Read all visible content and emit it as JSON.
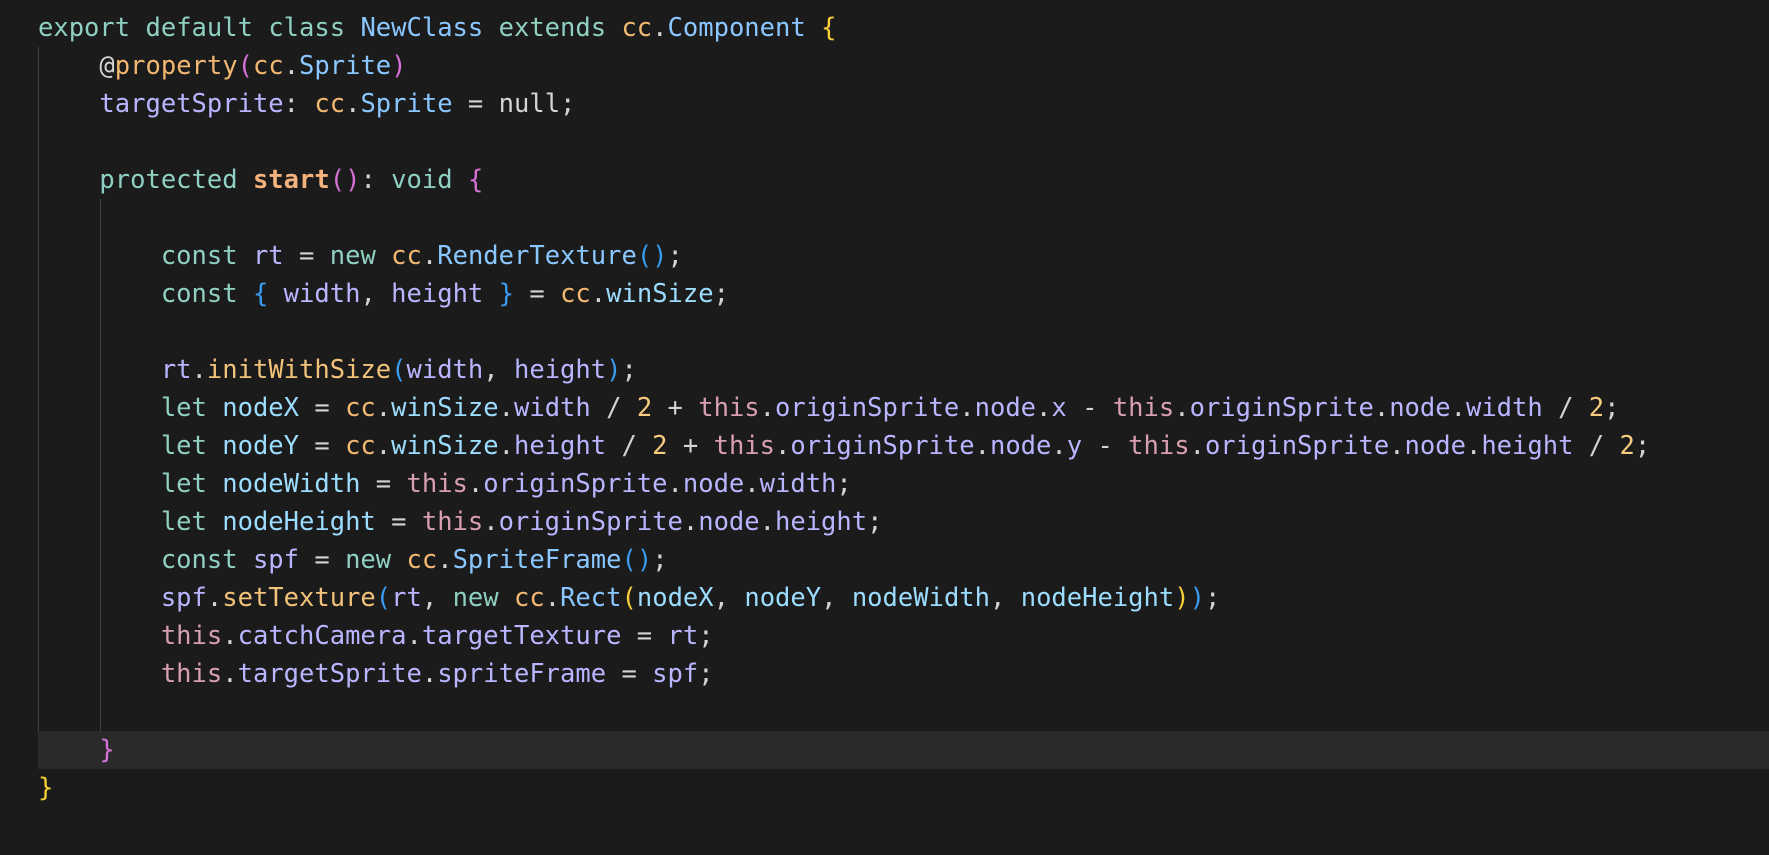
{
  "editor": {
    "theme_colors": {
      "background": "#1b1b1b",
      "current_line": "#2a2a2a",
      "keyword": "#8fd0c3",
      "class_name": "#8ac7ff",
      "cc_namespace": "#f2b872",
      "identifier": "#b9b5ff",
      "number": "#f7cc7d",
      "this_keyword": "#d8a0ae",
      "bracket_gold": "#f7d038",
      "bracket_pink": "#d672d6",
      "bracket_blue": "#3a9cf0"
    },
    "current_line_index": 19,
    "lines": [
      [
        {
          "t": "export",
          "c": "keyword"
        },
        {
          "t": " ",
          "c": "punct"
        },
        {
          "t": "default",
          "c": "keyword"
        },
        {
          "t": " ",
          "c": "punct"
        },
        {
          "t": "class",
          "c": "keyword"
        },
        {
          "t": " ",
          "c": "punct"
        },
        {
          "t": "NewClass",
          "c": "class-name"
        },
        {
          "t": " ",
          "c": "punct"
        },
        {
          "t": "extends",
          "c": "keyword"
        },
        {
          "t": " ",
          "c": "punct"
        },
        {
          "t": "cc",
          "c": "cc"
        },
        {
          "t": ".",
          "c": "punct"
        },
        {
          "t": "Component",
          "c": "class-name"
        },
        {
          "t": " ",
          "c": "punct"
        },
        {
          "t": "{",
          "c": "bracket-gold"
        }
      ],
      [
        {
          "t": "    ",
          "c": "punct"
        },
        {
          "t": "@",
          "c": "decorator"
        },
        {
          "t": "property",
          "c": "property-dec"
        },
        {
          "t": "(",
          "c": "bracket-pink"
        },
        {
          "t": "cc",
          "c": "cc"
        },
        {
          "t": ".",
          "c": "punct"
        },
        {
          "t": "Sprite",
          "c": "class-name"
        },
        {
          "t": ")",
          "c": "bracket-pink"
        }
      ],
      [
        {
          "t": "    ",
          "c": "punct"
        },
        {
          "t": "targetSprite",
          "c": "identifier"
        },
        {
          "t": ": ",
          "c": "punct"
        },
        {
          "t": "cc",
          "c": "cc"
        },
        {
          "t": ".",
          "c": "punct"
        },
        {
          "t": "Sprite",
          "c": "class-name"
        },
        {
          "t": " = null;",
          "c": "punct"
        }
      ],
      [],
      [
        {
          "t": "    ",
          "c": "punct"
        },
        {
          "t": "protected",
          "c": "keyword"
        },
        {
          "t": " ",
          "c": "punct"
        },
        {
          "t": "start",
          "c": "function-bold"
        },
        {
          "t": "()",
          "c": "bracket-pink"
        },
        {
          "t": ": ",
          "c": "punct"
        },
        {
          "t": "void",
          "c": "keyword"
        },
        {
          "t": " ",
          "c": "punct"
        },
        {
          "t": "{",
          "c": "bracket-pink"
        }
      ],
      [],
      [
        {
          "t": "        ",
          "c": "punct"
        },
        {
          "t": "const",
          "c": "keyword"
        },
        {
          "t": " ",
          "c": "punct"
        },
        {
          "t": "rt",
          "c": "identifier"
        },
        {
          "t": " = ",
          "c": "punct"
        },
        {
          "t": "new",
          "c": "keyword"
        },
        {
          "t": " ",
          "c": "punct"
        },
        {
          "t": "cc",
          "c": "cc"
        },
        {
          "t": ".",
          "c": "punct"
        },
        {
          "t": "RenderTexture",
          "c": "class-name"
        },
        {
          "t": "()",
          "c": "bracket-blue"
        },
        {
          "t": ";",
          "c": "punct"
        }
      ],
      [
        {
          "t": "        ",
          "c": "punct"
        },
        {
          "t": "const",
          "c": "keyword"
        },
        {
          "t": " ",
          "c": "punct"
        },
        {
          "t": "{",
          "c": "bracket-blue"
        },
        {
          "t": " ",
          "c": "punct"
        },
        {
          "t": "width",
          "c": "identifier"
        },
        {
          "t": ", ",
          "c": "punct"
        },
        {
          "t": "height",
          "c": "identifier"
        },
        {
          "t": " ",
          "c": "punct"
        },
        {
          "t": "}",
          "c": "bracket-blue"
        },
        {
          "t": " = ",
          "c": "punct"
        },
        {
          "t": "cc",
          "c": "cc"
        },
        {
          "t": ".",
          "c": "punct"
        },
        {
          "t": "winSize",
          "c": "variable"
        },
        {
          "t": ";",
          "c": "punct"
        }
      ],
      [],
      [
        {
          "t": "        ",
          "c": "punct"
        },
        {
          "t": "rt",
          "c": "identifier"
        },
        {
          "t": ".",
          "c": "punct"
        },
        {
          "t": "initWithSize",
          "c": "function"
        },
        {
          "t": "(",
          "c": "bracket-blue"
        },
        {
          "t": "width",
          "c": "identifier"
        },
        {
          "t": ", ",
          "c": "punct"
        },
        {
          "t": "height",
          "c": "identifier"
        },
        {
          "t": ")",
          "c": "bracket-blue"
        },
        {
          "t": ";",
          "c": "punct"
        }
      ],
      [
        {
          "t": "        ",
          "c": "punct"
        },
        {
          "t": "let",
          "c": "keyword"
        },
        {
          "t": " ",
          "c": "punct"
        },
        {
          "t": "nodeX",
          "c": "variable"
        },
        {
          "t": " = ",
          "c": "punct"
        },
        {
          "t": "cc",
          "c": "cc"
        },
        {
          "t": ".",
          "c": "punct"
        },
        {
          "t": "winSize",
          "c": "variable"
        },
        {
          "t": ".",
          "c": "punct"
        },
        {
          "t": "width",
          "c": "identifier"
        },
        {
          "t": " / ",
          "c": "punct"
        },
        {
          "t": "2",
          "c": "number"
        },
        {
          "t": " + ",
          "c": "punct"
        },
        {
          "t": "this",
          "c": "this-kw"
        },
        {
          "t": ".",
          "c": "punct"
        },
        {
          "t": "originSprite",
          "c": "identifier"
        },
        {
          "t": ".",
          "c": "punct"
        },
        {
          "t": "node",
          "c": "identifier"
        },
        {
          "t": ".",
          "c": "punct"
        },
        {
          "t": "x",
          "c": "identifier"
        },
        {
          "t": " - ",
          "c": "punct"
        },
        {
          "t": "this",
          "c": "this-kw"
        },
        {
          "t": ".",
          "c": "punct"
        },
        {
          "t": "originSprite",
          "c": "identifier"
        },
        {
          "t": ".",
          "c": "punct"
        },
        {
          "t": "node",
          "c": "identifier"
        },
        {
          "t": ".",
          "c": "punct"
        },
        {
          "t": "width",
          "c": "identifier"
        },
        {
          "t": " / ",
          "c": "punct"
        },
        {
          "t": "2",
          "c": "number"
        },
        {
          "t": ";",
          "c": "punct"
        }
      ],
      [
        {
          "t": "        ",
          "c": "punct"
        },
        {
          "t": "let",
          "c": "keyword"
        },
        {
          "t": " ",
          "c": "punct"
        },
        {
          "t": "nodeY",
          "c": "variable"
        },
        {
          "t": " = ",
          "c": "punct"
        },
        {
          "t": "cc",
          "c": "cc"
        },
        {
          "t": ".",
          "c": "punct"
        },
        {
          "t": "winSize",
          "c": "variable"
        },
        {
          "t": ".",
          "c": "punct"
        },
        {
          "t": "height",
          "c": "identifier"
        },
        {
          "t": " / ",
          "c": "punct"
        },
        {
          "t": "2",
          "c": "number"
        },
        {
          "t": " + ",
          "c": "punct"
        },
        {
          "t": "this",
          "c": "this-kw"
        },
        {
          "t": ".",
          "c": "punct"
        },
        {
          "t": "originSprite",
          "c": "identifier"
        },
        {
          "t": ".",
          "c": "punct"
        },
        {
          "t": "node",
          "c": "identifier"
        },
        {
          "t": ".",
          "c": "punct"
        },
        {
          "t": "y",
          "c": "identifier"
        },
        {
          "t": " - ",
          "c": "punct"
        },
        {
          "t": "this",
          "c": "this-kw"
        },
        {
          "t": ".",
          "c": "punct"
        },
        {
          "t": "originSprite",
          "c": "identifier"
        },
        {
          "t": ".",
          "c": "punct"
        },
        {
          "t": "node",
          "c": "identifier"
        },
        {
          "t": ".",
          "c": "punct"
        },
        {
          "t": "height",
          "c": "identifier"
        },
        {
          "t": " / ",
          "c": "punct"
        },
        {
          "t": "2",
          "c": "number"
        },
        {
          "t": ";",
          "c": "punct"
        }
      ],
      [
        {
          "t": "        ",
          "c": "punct"
        },
        {
          "t": "let",
          "c": "keyword"
        },
        {
          "t": " ",
          "c": "punct"
        },
        {
          "t": "nodeWidth",
          "c": "variable"
        },
        {
          "t": " = ",
          "c": "punct"
        },
        {
          "t": "this",
          "c": "this-kw"
        },
        {
          "t": ".",
          "c": "punct"
        },
        {
          "t": "originSprite",
          "c": "identifier"
        },
        {
          "t": ".",
          "c": "punct"
        },
        {
          "t": "node",
          "c": "identifier"
        },
        {
          "t": ".",
          "c": "punct"
        },
        {
          "t": "width",
          "c": "identifier"
        },
        {
          "t": ";",
          "c": "punct"
        }
      ],
      [
        {
          "t": "        ",
          "c": "punct"
        },
        {
          "t": "let",
          "c": "keyword"
        },
        {
          "t": " ",
          "c": "punct"
        },
        {
          "t": "nodeHeight",
          "c": "variable"
        },
        {
          "t": " = ",
          "c": "punct"
        },
        {
          "t": "this",
          "c": "this-kw"
        },
        {
          "t": ".",
          "c": "punct"
        },
        {
          "t": "originSprite",
          "c": "identifier"
        },
        {
          "t": ".",
          "c": "punct"
        },
        {
          "t": "node",
          "c": "identifier"
        },
        {
          "t": ".",
          "c": "punct"
        },
        {
          "t": "height",
          "c": "identifier"
        },
        {
          "t": ";",
          "c": "punct"
        }
      ],
      [
        {
          "t": "        ",
          "c": "punct"
        },
        {
          "t": "const",
          "c": "keyword"
        },
        {
          "t": " ",
          "c": "punct"
        },
        {
          "t": "spf",
          "c": "identifier"
        },
        {
          "t": " = ",
          "c": "punct"
        },
        {
          "t": "new",
          "c": "keyword"
        },
        {
          "t": " ",
          "c": "punct"
        },
        {
          "t": "cc",
          "c": "cc"
        },
        {
          "t": ".",
          "c": "punct"
        },
        {
          "t": "SpriteFrame",
          "c": "class-name"
        },
        {
          "t": "()",
          "c": "bracket-blue"
        },
        {
          "t": ";",
          "c": "punct"
        }
      ],
      [
        {
          "t": "        ",
          "c": "punct"
        },
        {
          "t": "spf",
          "c": "identifier"
        },
        {
          "t": ".",
          "c": "punct"
        },
        {
          "t": "setTexture",
          "c": "function"
        },
        {
          "t": "(",
          "c": "bracket-blue"
        },
        {
          "t": "rt",
          "c": "identifier"
        },
        {
          "t": ", ",
          "c": "punct"
        },
        {
          "t": "new",
          "c": "keyword"
        },
        {
          "t": " ",
          "c": "punct"
        },
        {
          "t": "cc",
          "c": "cc"
        },
        {
          "t": ".",
          "c": "punct"
        },
        {
          "t": "Rect",
          "c": "class-name"
        },
        {
          "t": "(",
          "c": "bracket-gold"
        },
        {
          "t": "nodeX",
          "c": "variable"
        },
        {
          "t": ", ",
          "c": "punct"
        },
        {
          "t": "nodeY",
          "c": "variable"
        },
        {
          "t": ", ",
          "c": "punct"
        },
        {
          "t": "nodeWidth",
          "c": "variable"
        },
        {
          "t": ", ",
          "c": "punct"
        },
        {
          "t": "nodeHeight",
          "c": "variable"
        },
        {
          "t": ")",
          "c": "bracket-gold"
        },
        {
          "t": ")",
          "c": "bracket-blue"
        },
        {
          "t": ";",
          "c": "punct"
        }
      ],
      [
        {
          "t": "        ",
          "c": "punct"
        },
        {
          "t": "this",
          "c": "this-kw"
        },
        {
          "t": ".",
          "c": "punct"
        },
        {
          "t": "catchCamera",
          "c": "identifier"
        },
        {
          "t": ".",
          "c": "punct"
        },
        {
          "t": "targetTexture",
          "c": "identifier"
        },
        {
          "t": " = ",
          "c": "punct"
        },
        {
          "t": "rt",
          "c": "identifier"
        },
        {
          "t": ";",
          "c": "punct"
        }
      ],
      [
        {
          "t": "        ",
          "c": "punct"
        },
        {
          "t": "this",
          "c": "this-kw"
        },
        {
          "t": ".",
          "c": "punct"
        },
        {
          "t": "targetSprite",
          "c": "identifier"
        },
        {
          "t": ".",
          "c": "punct"
        },
        {
          "t": "spriteFrame",
          "c": "identifier"
        },
        {
          "t": " = ",
          "c": "punct"
        },
        {
          "t": "spf",
          "c": "identifier"
        },
        {
          "t": ";",
          "c": "punct"
        }
      ],
      [],
      [
        {
          "t": "    ",
          "c": "punct"
        },
        {
          "t": "}",
          "c": "bracket-pink"
        }
      ],
      [
        {
          "t": "}",
          "c": "bracket-gold"
        }
      ]
    ]
  }
}
